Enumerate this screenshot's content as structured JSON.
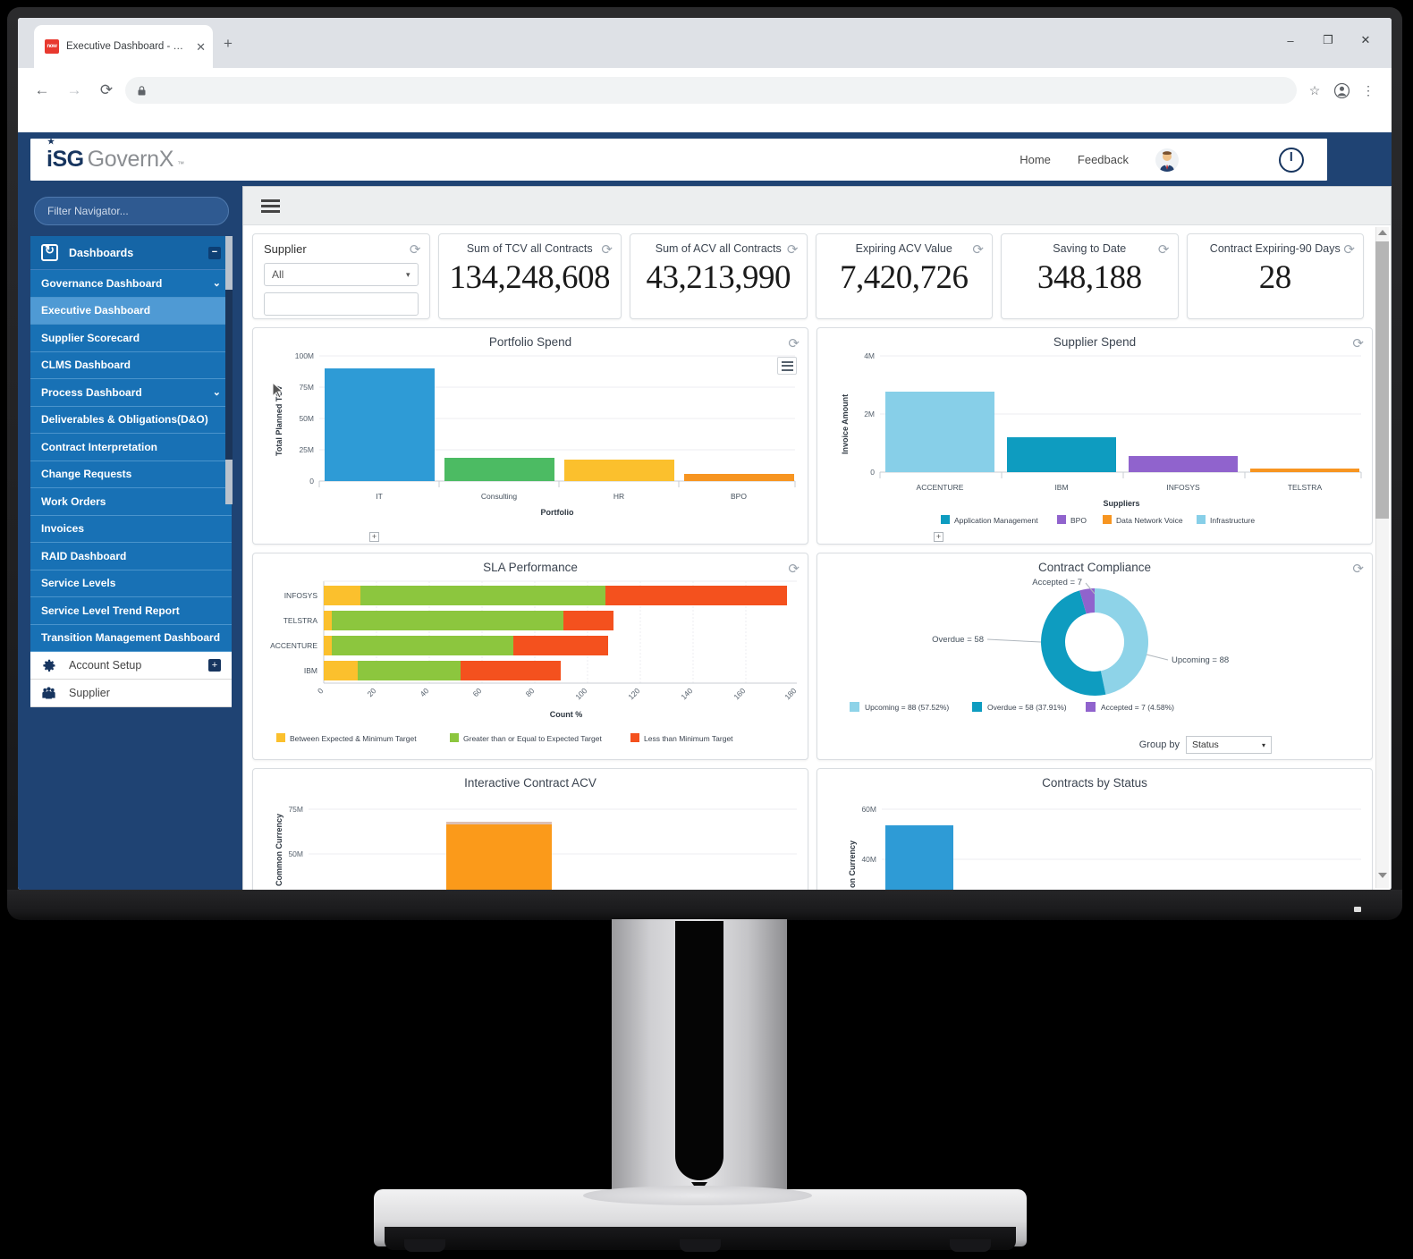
{
  "browser": {
    "tab_title": "Executive Dashboard - GovernX",
    "tab_favicon_text": "now",
    "close_glyph": "✕",
    "newtab_glyph": "+",
    "minimize_glyph": "–",
    "maximize_glyph": "❐",
    "window_close_glyph": "✕",
    "back_glyph": "←",
    "forward_glyph": "→",
    "reload_glyph": "⟳",
    "lock_glyph": "🔒",
    "url": "",
    "star_glyph": "☆",
    "profile_glyph": "●",
    "menu_glyph": "⋮"
  },
  "app_header": {
    "logo_primary": "iSG",
    "logo_secondary": "GovernX",
    "logo_tm": "™",
    "links": [
      "Home",
      "Feedback"
    ],
    "avatar_name": "user-avatar",
    "power_name": "power-off-button"
  },
  "sidebar": {
    "filter_placeholder": "Filter Navigator...",
    "section": {
      "label": "Dashboards",
      "toggle": "−"
    },
    "items": [
      {
        "label": "Governance Dashboard",
        "chevron": "⌄",
        "selected": false
      },
      {
        "label": "Executive Dashboard",
        "chevron": "",
        "selected": true
      },
      {
        "label": "Supplier Scorecard",
        "chevron": "",
        "selected": false
      },
      {
        "label": "CLMS Dashboard",
        "chevron": "",
        "selected": false
      },
      {
        "label": "Process Dashboard",
        "chevron": "⌄",
        "selected": false
      },
      {
        "label": "Deliverables & Obligations(D&O)",
        "chevron": "",
        "selected": false
      },
      {
        "label": "Contract Interpretation",
        "chevron": "",
        "selected": false
      },
      {
        "label": "Change Requests",
        "chevron": "",
        "selected": false
      },
      {
        "label": "Work Orders",
        "chevron": "",
        "selected": false
      },
      {
        "label": "Invoices",
        "chevron": "",
        "selected": false
      },
      {
        "label": "RAID Dashboard",
        "chevron": "",
        "selected": false
      },
      {
        "label": "Service Levels",
        "chevron": "",
        "selected": false
      },
      {
        "label": "Service Level Trend Report",
        "chevron": "",
        "selected": false
      },
      {
        "label": "Transition Management Dashboard",
        "chevron": "",
        "selected": false
      }
    ],
    "footer_items": [
      {
        "label": "Account Setup",
        "toggle": "+",
        "icon": "gear-icon"
      },
      {
        "label": "Supplier",
        "toggle": "",
        "icon": "people-icon"
      }
    ],
    "collapse_glyph": "←"
  },
  "kpis": {
    "supplier_filter": {
      "title": "Supplier",
      "selected": "All",
      "caret": "▾",
      "refresh": "⟳"
    },
    "cards": [
      {
        "title": "Sum of TCV all Contracts",
        "value": "134,248,608",
        "refresh": "⟳"
      },
      {
        "title": "Sum of ACV all Contracts",
        "value": "43,213,990",
        "refresh": "⟳"
      },
      {
        "title": "Expiring ACV Value",
        "value": "7,420,726",
        "refresh": "⟳"
      },
      {
        "title": "Saving to Date",
        "value": "348,188",
        "refresh": "⟳"
      },
      {
        "title": "Contract Expiring-90 Days",
        "value": "28",
        "refresh": "⟳"
      }
    ]
  },
  "panels": {
    "portfolio_spend": {
      "title": "Portfolio Spend",
      "refresh": "⟳",
      "expand": "+",
      "menu": "chart-menu-icon"
    },
    "supplier_spend": {
      "title": "Supplier Spend",
      "refresh": "⟳",
      "expand": "+"
    },
    "sla_performance": {
      "title": "SLA Performance",
      "refresh": "⟳"
    },
    "contract_compliance": {
      "title": "Contract Compliance",
      "refresh": "⟳",
      "group_by_label": "Group by",
      "group_by_value": "Status",
      "caret": "▾"
    },
    "interactive_contract_acv": {
      "title": "Interactive Contract ACV"
    },
    "contracts_by_status": {
      "title": "Contracts by Status"
    }
  },
  "chart_data": [
    {
      "type": "bar",
      "name": "portfolio-spend",
      "title": "Portfolio Spend",
      "xlabel": "Portfolio",
      "ylabel": "Total Planned TCV",
      "categories": [
        "IT",
        "Consulting",
        "HR",
        "BPO"
      ],
      "values": [
        90000000,
        18500000,
        17500000,
        6000000
      ],
      "colors": [
        "#2e9bd6",
        "#4cbb63",
        "#fbc02d",
        "#f79521"
      ],
      "ylim": [
        0,
        100000000
      ],
      "yticks": [
        0,
        25000000,
        50000000,
        75000000,
        100000000
      ],
      "ytick_labels": [
        "0",
        "25M",
        "50M",
        "75M",
        "100M"
      ],
      "grid": true,
      "legend": false
    },
    {
      "type": "bar",
      "name": "supplier-spend",
      "title": "Supplier Spend",
      "xlabel": "Suppliers",
      "ylabel": "Invoice Amount",
      "categories": [
        "ACCENTURE",
        "IBM",
        "INFOSYS",
        "TELSTRA"
      ],
      "values": [
        2750000,
        1200000,
        550000,
        110000
      ],
      "colors": [
        "#87cfe8",
        "#0e9cc0",
        "#9063cd",
        "#f79521"
      ],
      "ylim": [
        0,
        4000000
      ],
      "yticks": [
        0,
        2000000,
        4000000
      ],
      "ytick_labels": [
        "0",
        "2M",
        "4M"
      ],
      "grid": true,
      "legend_position": "bottom",
      "legend": [
        {
          "label": "Application Management",
          "color": "#0e9cc0"
        },
        {
          "label": "BPO",
          "color": "#9063cd"
        },
        {
          "label": "Data Network Voice",
          "color": "#f79521"
        },
        {
          "label": "Infrastructure",
          "color": "#87cfe8"
        }
      ]
    },
    {
      "type": "bar",
      "orientation": "horizontal",
      "stacked": true,
      "name": "sla-performance",
      "title": "SLA Performance",
      "xlabel": "Count %",
      "ylabel": "",
      "categories": [
        "INFOSYS",
        "TELSTRA",
        "ACCENTURE",
        "IBM"
      ],
      "series": [
        {
          "name": "Between Expected & Minimum Target",
          "color": "#fbc02d",
          "values": [
            14,
            3,
            3,
            13
          ]
        },
        {
          "name": "Greater than or Equal to Expected Target",
          "color": "#8cc63e",
          "values": [
            93,
            88,
            69,
            39
          ]
        },
        {
          "name": "Less than Minimum Target",
          "color": "#f4511e",
          "values": [
            69,
            19,
            36,
            38
          ]
        }
      ],
      "xlim": [
        0,
        180
      ],
      "xticks": [
        0,
        20,
        40,
        60,
        80,
        100,
        120,
        140,
        160,
        180
      ],
      "grid": true,
      "legend_position": "bottom"
    },
    {
      "type": "pie",
      "variant": "donut",
      "name": "contract-compliance",
      "title": "Contract Compliance",
      "labels": [
        "Upcoming",
        "Overdue",
        "Accepted"
      ],
      "values": [
        88,
        58,
        7
      ],
      "percents": [
        57.52,
        37.91,
        4.58
      ],
      "colors": [
        "#8ed3e8",
        "#0e9cc0",
        "#9063cd"
      ],
      "callouts": [
        "Upcoming = 88",
        "Overdue = 58",
        "Accepted = 7"
      ],
      "legend": [
        {
          "label": "Upcoming = 88 (57.52%)",
          "color": "#8ed3e8"
        },
        {
          "label": "Overdue = 58 (37.91%)",
          "color": "#0e9cc0"
        },
        {
          "label": "Accepted = 7 (4.58%)",
          "color": "#9063cd"
        }
      ],
      "legend_position": "bottom"
    },
    {
      "type": "bar",
      "name": "interactive-contract-acv",
      "title": "Interactive Contract ACV",
      "ylabel": "Common Currency",
      "categories": [
        ""
      ],
      "values": [
        68000000
      ],
      "colors": [
        "#fb9a1a"
      ],
      "ylim": [
        0,
        80000000
      ],
      "yticks": [
        50000000,
        75000000
      ],
      "ytick_labels": [
        "50M",
        "75M"
      ],
      "grid": true
    },
    {
      "type": "bar",
      "name": "contracts-by-status",
      "title": "Contracts by Status",
      "ylabel": "on Currency",
      "categories": [
        ""
      ],
      "values": [
        54000000
      ],
      "colors": [
        "#2e9bd6"
      ],
      "ylim": [
        0,
        65000000
      ],
      "yticks": [
        40000000,
        60000000
      ],
      "ytick_labels": [
        "40M",
        "60M"
      ],
      "grid": true
    }
  ]
}
